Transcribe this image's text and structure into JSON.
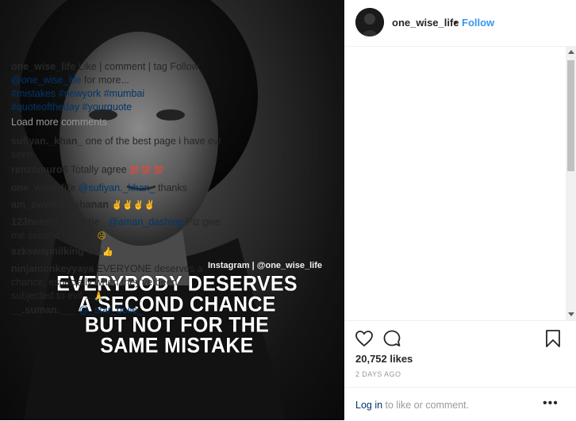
{
  "photo": {
    "watermark": "Instagram | @one_wise_life",
    "quote_lines": [
      "EVERYBODY DESERVES",
      "A SECOND CHANCE",
      "BUT NOT FOR THE",
      "SAME MISTAKE"
    ]
  },
  "header": {
    "username": "one_wise_life",
    "separator": "•",
    "follow_label": "Follow"
  },
  "caption": {
    "user": "one_wise_life",
    "text": " Like | comment | tag Follow ",
    "mention": "@one_wise_life",
    "text2": " for more...",
    "hashtags_line1": "#mistakes #newyork #mumbai",
    "hashtags_line2": "#quoteoftheday #yourquote"
  },
  "load_more": "Load more comments",
  "comments": [
    {
      "user": "sufiyan._khan_",
      "text": " one of the best page i have evr seen"
    },
    {
      "user": "renzomuro6",
      "text": " Totally agree "
    },
    {
      "user": "one_wise_life",
      "mention": " @sufiyan._khan_",
      "text": " thanks"
    },
    {
      "user": "am_swethamohanan",
      "text": " "
    },
    {
      "user": "123tweety_sweetie_",
      "mention": " @aman_dashing",
      "text": " Plz give me second chance "
    },
    {
      "user": "szkswapnilking",
      "text": " Yes"
    },
    {
      "user": "ninjamonkeyyaya",
      "text": " EVERYONE deserves a chance, especially when they've been subjected to evil ..."
    },
    {
      "user": "__.suman.___",
      "mention": " @_star_boiie_",
      "text": ""
    }
  ],
  "likes": "20,752 likes",
  "date": "2 DAYS AGO",
  "footer": {
    "login_link": "Log in",
    "login_text": " to like or comment.",
    "more_label": "•••"
  },
  "icons": [
    "heart-icon",
    "comment-icon",
    "bookmark-icon",
    "more-options-icon"
  ]
}
